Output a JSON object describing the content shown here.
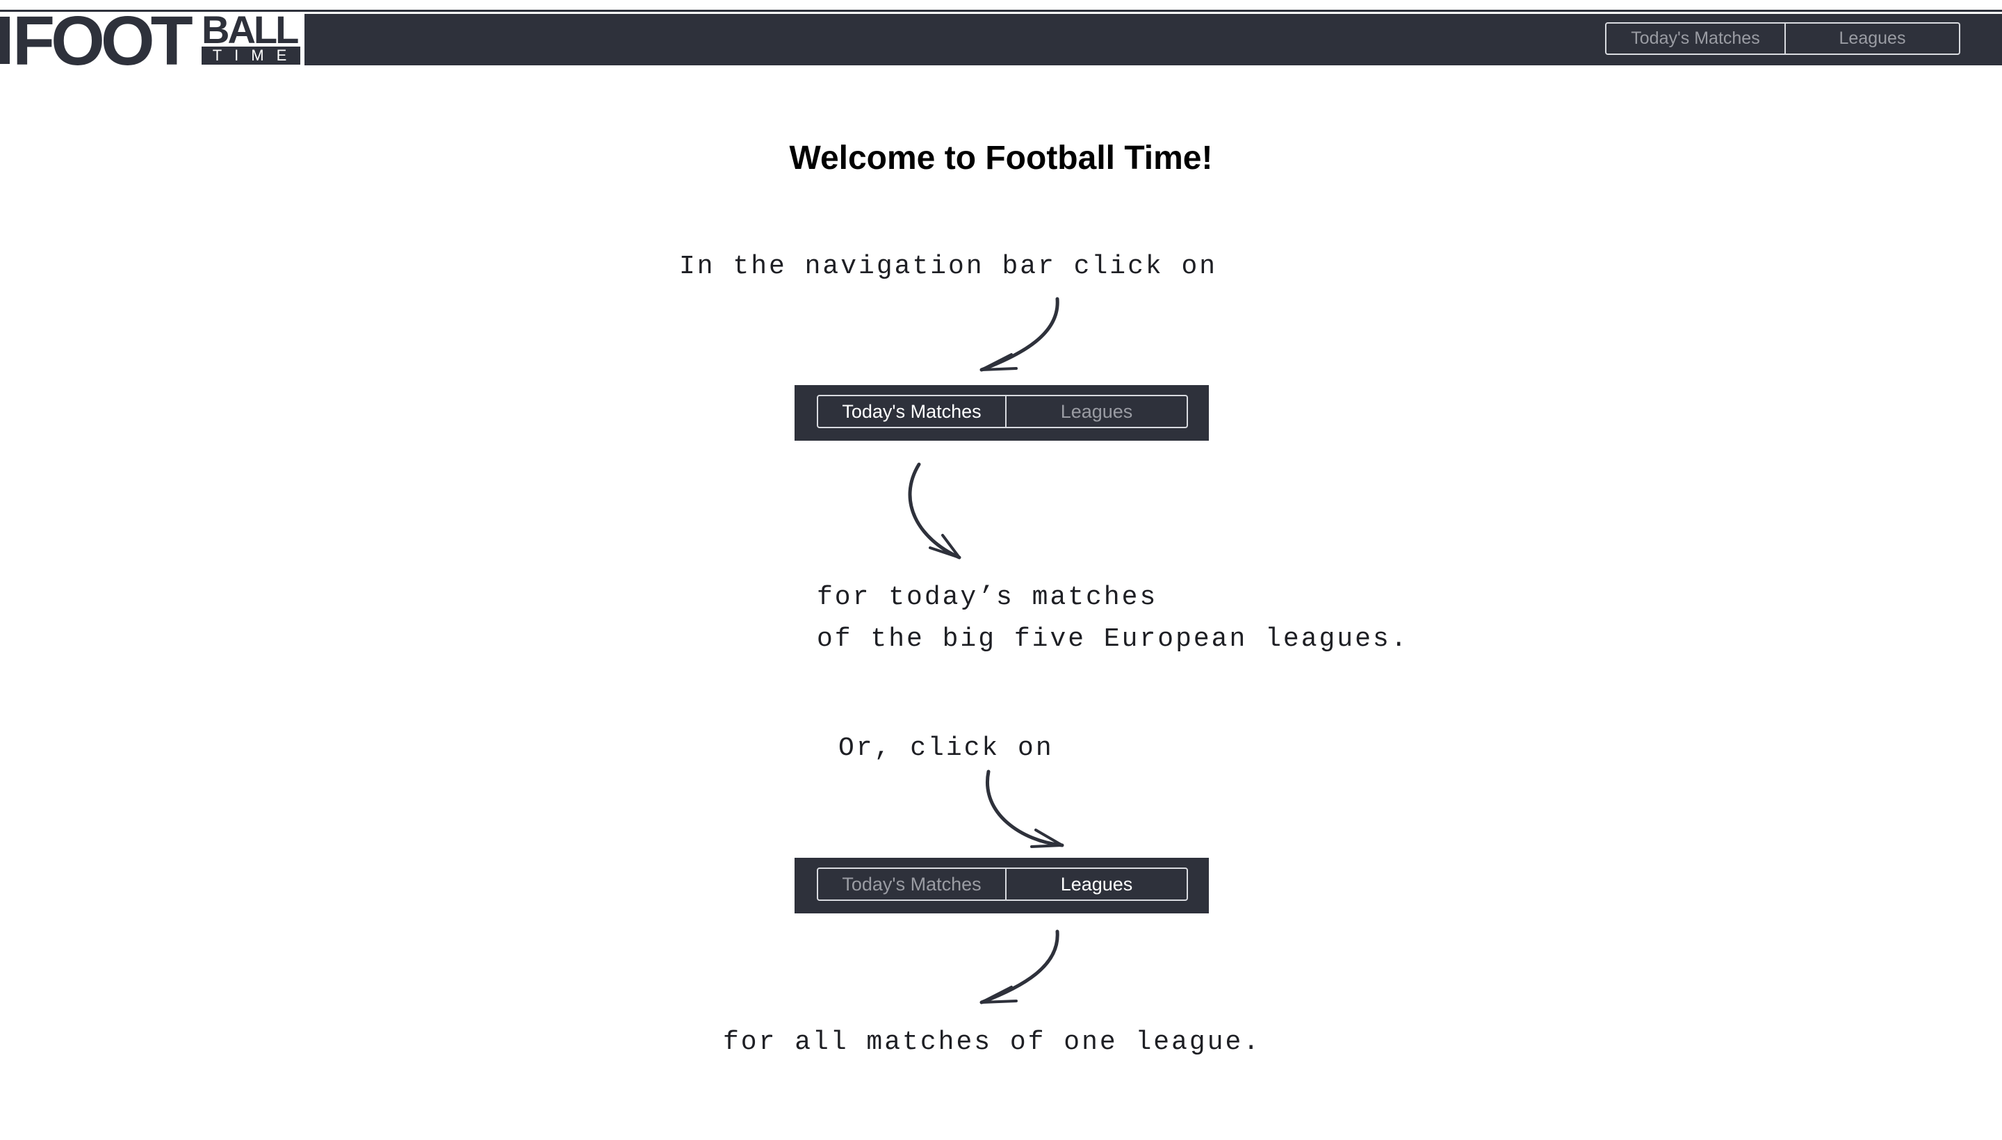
{
  "logo": {
    "foot": "FOOT",
    "ball": "BALL",
    "time": "TIME"
  },
  "nav": {
    "todays_matches": "Today's Matches",
    "leagues": "Leagues"
  },
  "welcome_title": "Welcome to Football Time!",
  "instructions": {
    "line1": "In the navigation bar click on",
    "line2": "for today’s matches",
    "line3": "of the big five European leagues.",
    "line4": "Or, click on",
    "line5": "for all matches of one league."
  },
  "colors": {
    "navbar": "#2e313b",
    "inactive_text": "#9a9ca3",
    "active_text": "#ffffff"
  },
  "icons": [
    "curved-arrow-icon"
  ]
}
